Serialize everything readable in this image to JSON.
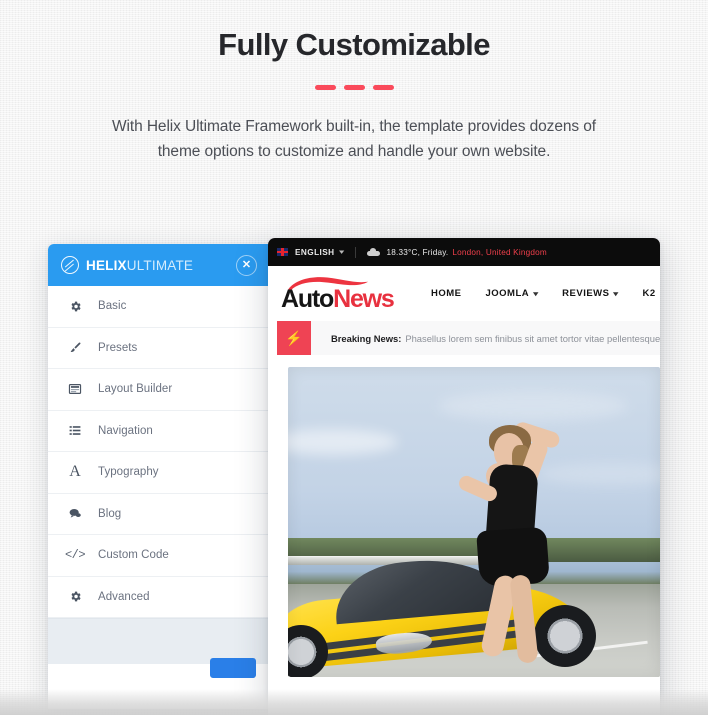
{
  "hero": {
    "title": "Fully Customizable",
    "description": "With Helix Ultimate Framework built-in, the template provides dozens of theme options to customize and handle your own website.",
    "accent_color": "#fa4a5b"
  },
  "helix_panel": {
    "brand_bold": "HELIX",
    "brand_light": "ULTIMATE",
    "close_label": "✕",
    "brand_color": "#2a9bf0",
    "menu": [
      {
        "label": "Basic",
        "icon": "gear-icon"
      },
      {
        "label": "Presets",
        "icon": "brush-icon"
      },
      {
        "label": "Layout Builder",
        "icon": "layout-icon"
      },
      {
        "label": "Navigation",
        "icon": "list-icon"
      },
      {
        "label": "Typography",
        "icon": "letter-a-icon"
      },
      {
        "label": "Blog",
        "icon": "comment-icon"
      },
      {
        "label": "Custom Code",
        "icon": "code-icon"
      },
      {
        "label": "Advanced",
        "icon": "gear-icon"
      }
    ]
  },
  "site": {
    "topbar": {
      "language": "ENGLISH",
      "weather": "18.33°C, Friday.",
      "location": "London, United Kingdom",
      "language_color": "#e9e9e9",
      "location_color": "#ef3f4b"
    },
    "brand": {
      "part_one": "Auto",
      "part_two": "News",
      "accent_color": "#e8313f"
    },
    "nav": [
      {
        "label": "HOME",
        "has_dropdown": false
      },
      {
        "label": "JOOMLA",
        "has_dropdown": true
      },
      {
        "label": "REVIEWS",
        "has_dropdown": true
      },
      {
        "label": "K2",
        "has_dropdown": true
      }
    ],
    "breaking": {
      "badge_icon": "bolt-icon",
      "label": "Breaking News:",
      "text": "Phasellus lorem sem finibus sit amet tortor vitae pellentesque tinci",
      "badge_color": "#ef4354"
    },
    "hero_image_alt": "Woman leaning on a yellow sports car on a racetrack"
  }
}
